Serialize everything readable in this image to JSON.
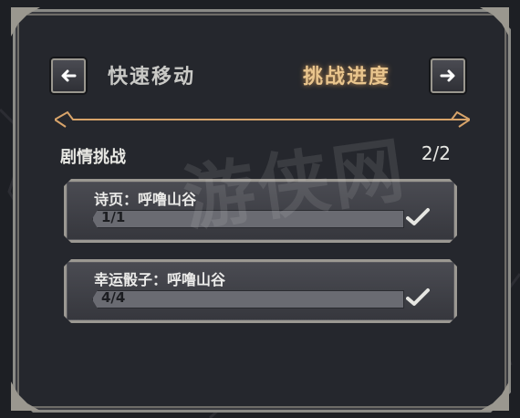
{
  "tabs": {
    "inactive": "快速移动",
    "active": "挑战进度"
  },
  "section": {
    "title": "剧情挑战",
    "count": "2/2"
  },
  "challenges": [
    {
      "title": "诗页：呼噜山谷",
      "progress_text": "1/1",
      "completed": true,
      "fraction": 1.0
    },
    {
      "title": "幸运骰子：呼噜山谷",
      "progress_text": "4/4",
      "completed": true,
      "fraction": 1.0
    }
  ],
  "watermark": "游侠网",
  "colors": {
    "accent": "#e9c58d",
    "frame": "#8a8a86",
    "panel": "#25272d"
  },
  "icons": {
    "prev": "arrow-left-icon",
    "next": "arrow-right-icon",
    "done": "checkmark-icon"
  }
}
